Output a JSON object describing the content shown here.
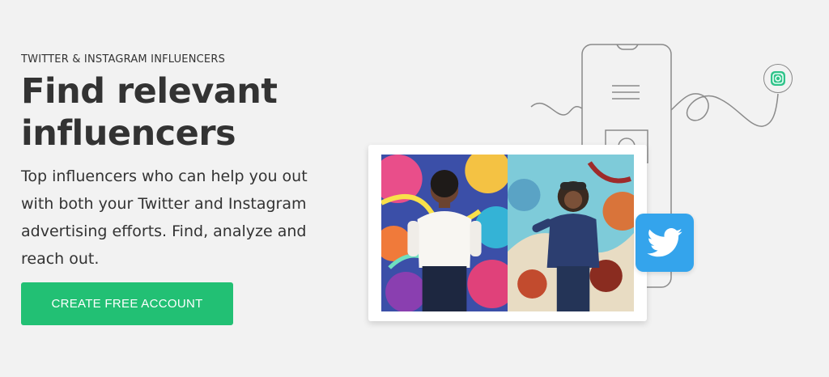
{
  "hero": {
    "eyebrow": "TWITTER & INSTAGRAM INFLUENCERS",
    "headline_line1": "Find relevant",
    "headline_line2": "influencers",
    "subtext": "Top influencers who can help you out with both your Twitter and Instagram advertising efforts. Find, analyze and reach out.",
    "cta_label": "CREATE FREE ACCOUNT"
  },
  "illustration": {
    "icons": [
      "phone-outline-icon",
      "twitter-bird-icon",
      "instagram-icon"
    ],
    "photos": [
      "influencer-photo-left",
      "influencer-photo-right"
    ]
  },
  "colors": {
    "background": "#f2f2f2",
    "cta": "#22c074",
    "twitter": "#34a4ec",
    "text": "#333333"
  }
}
